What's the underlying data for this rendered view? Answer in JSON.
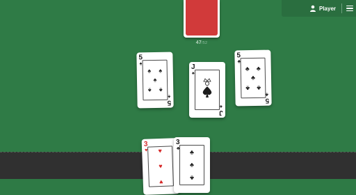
{
  "header": {
    "player_label": "Player",
    "player_icon": "user-icon",
    "menu_icon": "hamburger-menu-icon"
  },
  "deck": {
    "back_color": "#d13a3a",
    "count_current": "47",
    "count_total": "/52"
  },
  "table_cards": [
    {
      "rank": "5",
      "suit": "♠",
      "suit_name": "spades"
    },
    {
      "rank": "J",
      "suit": "♠",
      "suit_name": "spades"
    },
    {
      "rank": "5",
      "suit": "♣",
      "suit_name": "clubs"
    }
  ],
  "hand_cards": [
    {
      "rank": "3",
      "suit": "♥",
      "suit_name": "hearts"
    },
    {
      "rank": "3",
      "suit": "♣",
      "suit_name": "clubs"
    }
  ],
  "colors": {
    "table_felt": "#2f7b46",
    "hand_tray": "#303030",
    "red_suit": "#d62828",
    "black_suit": "#1d1d1d"
  }
}
